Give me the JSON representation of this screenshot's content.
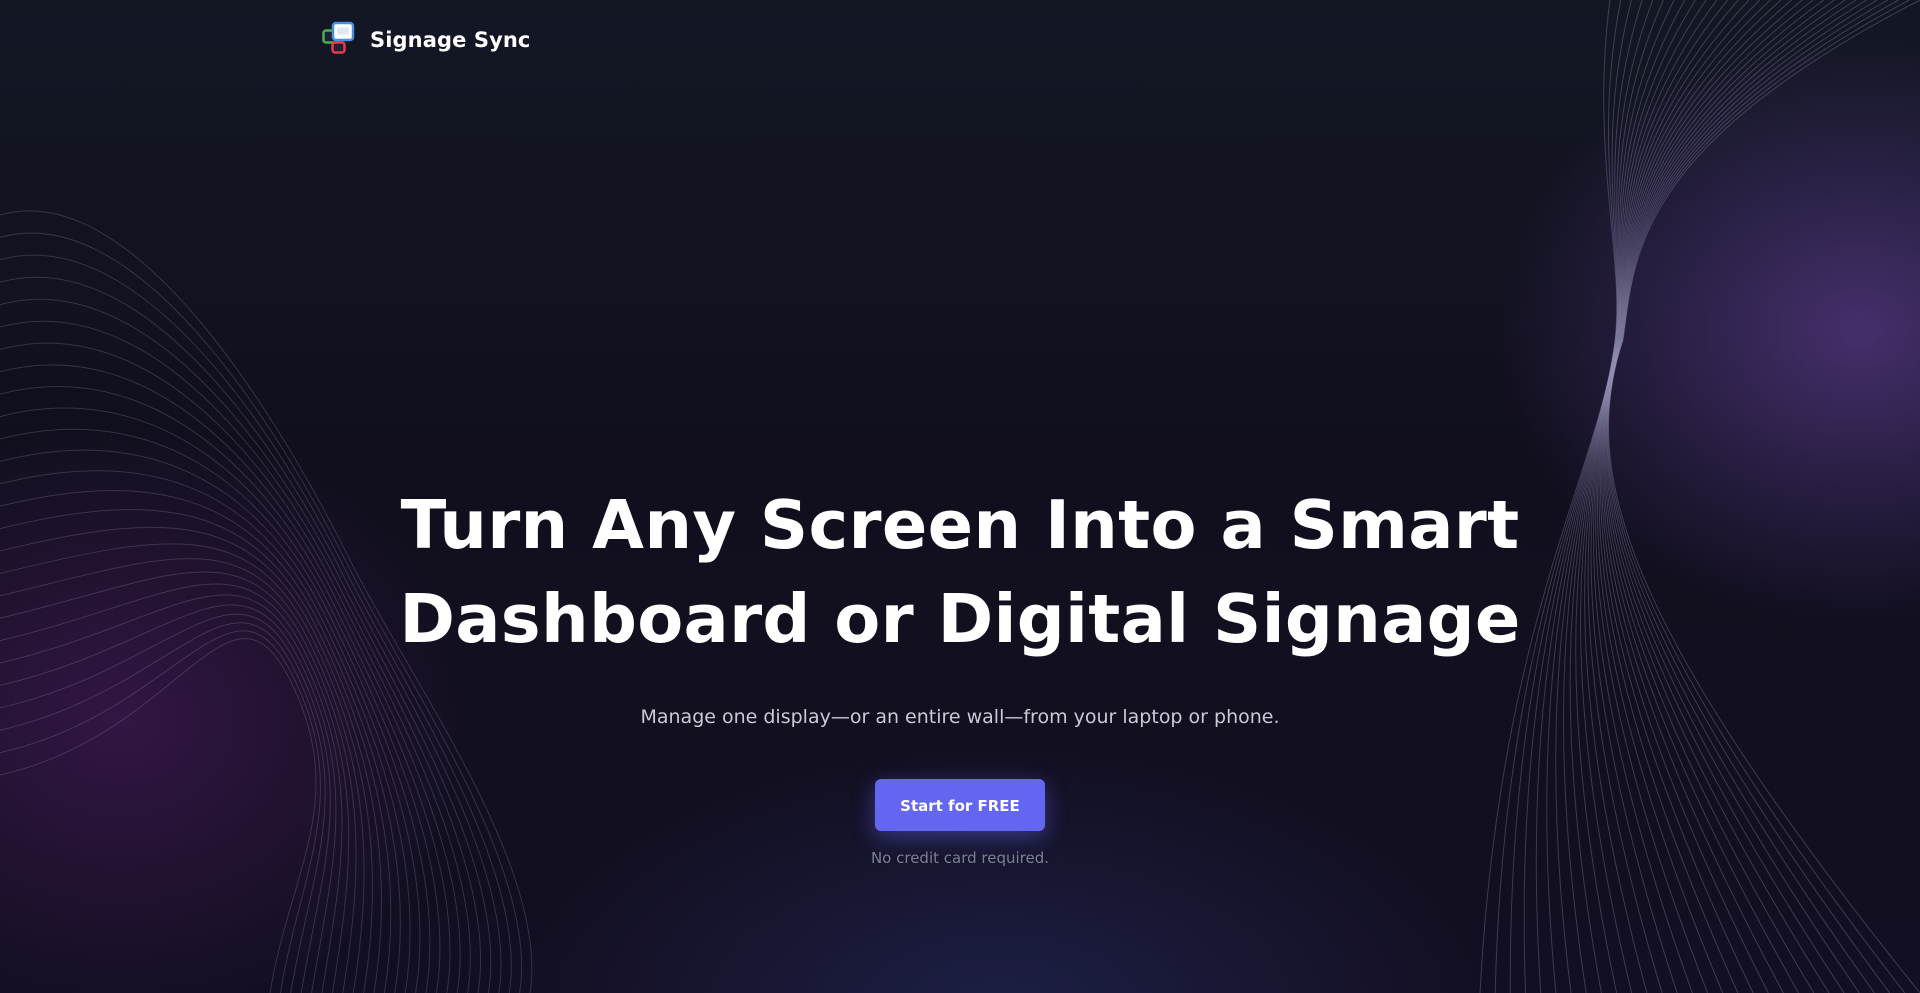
{
  "brand": {
    "name": "Signage Sync",
    "logo_icon": "stacked-screens-icon"
  },
  "hero": {
    "title_line1": "Turn Any Screen Into a Smart",
    "title_line2": "Dashboard or Digital Signage",
    "subtitle": "Manage one display—or an entire wall—from your laptop or phone.",
    "cta_label": "Start for FREE",
    "cta_note": "No credit card required."
  },
  "colors": {
    "background": "#12131f",
    "accent": "#6366f1",
    "logo_blue": "#4a90d9",
    "logo_green": "#4caf50",
    "logo_red": "#e53950"
  },
  "decorations": {
    "background_pattern": "flowing-line-waves"
  }
}
